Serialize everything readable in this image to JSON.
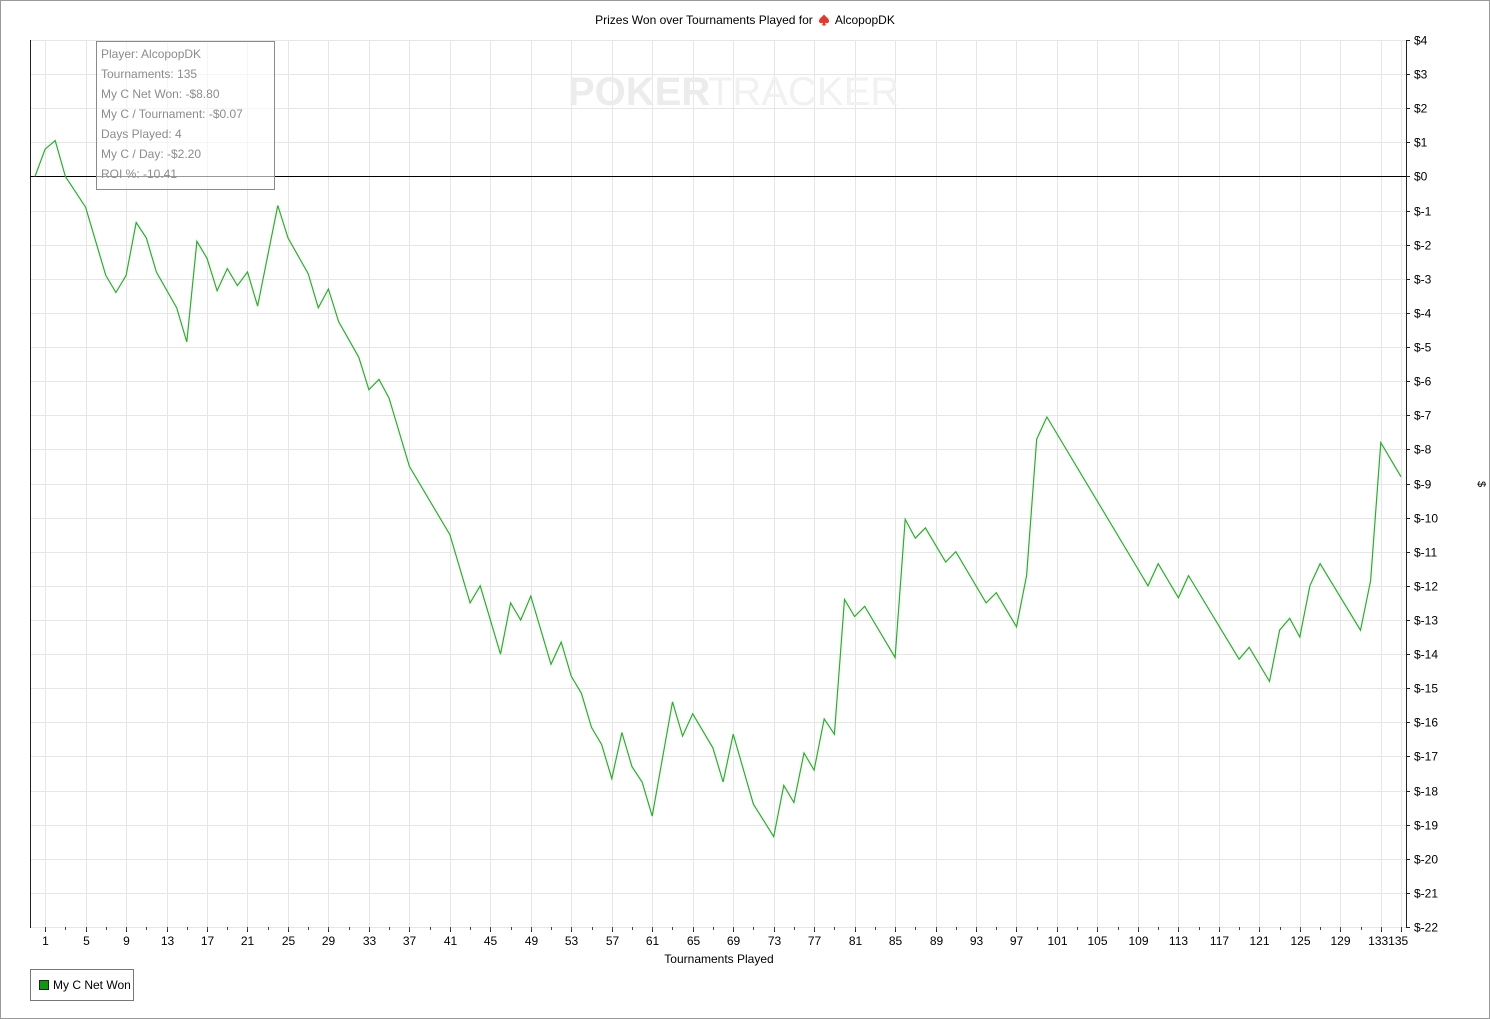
{
  "title": {
    "text": "Prizes Won over Tournaments Played for",
    "player": "AlcopopDK",
    "icon": "spade-icon"
  },
  "stats": {
    "player": "Player: AlcopopDK",
    "tournaments": "Tournaments: 135",
    "net_won": "My C Net Won: -$8.80",
    "per_tournament": "My C / Tournament: -$0.07",
    "days_played": "Days Played: 4",
    "per_day": "My C / Day: -$2.20",
    "roi": "ROI %: -10.41"
  },
  "watermark": {
    "left": "POKER",
    "right": "TRACKER"
  },
  "legend": {
    "label": "My C Net Won"
  },
  "colors": {
    "series": "#22b422",
    "grid": "#e6e6e6",
    "legend_swatch": "#0a9a0a",
    "spade": "#e8382b"
  },
  "chart_data": {
    "type": "line",
    "title": "Prizes Won over Tournaments Played for AlcopopDK",
    "xlabel": "Tournaments Played",
    "ylabel": "$",
    "xlim": [
      0,
      135
    ],
    "ylim": [
      -22,
      4
    ],
    "y_axis_position": "right",
    "grid": true,
    "legend_position": "bottom-left",
    "x_ticks": [
      1,
      5,
      9,
      13,
      17,
      21,
      25,
      29,
      33,
      37,
      41,
      45,
      49,
      53,
      57,
      61,
      65,
      69,
      73,
      77,
      81,
      85,
      89,
      93,
      97,
      101,
      105,
      109,
      113,
      117,
      121,
      125,
      129,
      133,
      135
    ],
    "x_tick_labels": [
      "1",
      "5",
      "9",
      "13",
      "17",
      "21",
      "25",
      "29",
      "33",
      "37",
      "41",
      "45",
      "49",
      "53",
      "57",
      "61",
      "65",
      "69",
      "73",
      "77",
      "81",
      "85",
      "89",
      "93",
      "97",
      "101",
      "105",
      "109",
      "113",
      "117",
      "121",
      "125",
      "129",
      "1331",
      "35"
    ],
    "y_ticks": [
      4,
      3,
      2,
      1,
      0,
      -1,
      -2,
      -3,
      -4,
      -5,
      -6,
      -7,
      -8,
      -9,
      -10,
      -11,
      -12,
      -13,
      -14,
      -15,
      -16,
      -17,
      -18,
      -19,
      -20,
      -21,
      -22
    ],
    "y_tick_labels": [
      "$4",
      "$3",
      "$2",
      "$1",
      "$0",
      "$-1",
      "$-2",
      "$-3",
      "$-4",
      "$-5",
      "$-6",
      "$-7",
      "$-8",
      "$-9",
      "$-10",
      "$-11",
      "$-12",
      "$-13",
      "$-14",
      "$-15",
      "$-16",
      "$-17",
      "$-18",
      "$-19",
      "$-20",
      "$-21",
      "$-22"
    ],
    "series": [
      {
        "name": "My C Net Won",
        "x": [
          0,
          1,
          2,
          3,
          5,
          7,
          8,
          9,
          10,
          11,
          12,
          14,
          15,
          16,
          17,
          18,
          19,
          20,
          21,
          22,
          24,
          25,
          27,
          28,
          29,
          30,
          32,
          33,
          34,
          35,
          37,
          41,
          43,
          44,
          46,
          47,
          48,
          49,
          51,
          52,
          53,
          54,
          55,
          56,
          57,
          58,
          59,
          60,
          61,
          63,
          64,
          65,
          67,
          68,
          69,
          71,
          73,
          74,
          75,
          76,
          77,
          78,
          79,
          80,
          81,
          82,
          85,
          86,
          87,
          88,
          90,
          91,
          94,
          95,
          97,
          98,
          99,
          100,
          110,
          111,
          113,
          114,
          119,
          120,
          122,
          123,
          124,
          125,
          126,
          127,
          131,
          132,
          133,
          135
        ],
        "y": [
          0,
          0.8,
          1.05,
          0,
          -0.9,
          -2.9,
          -3.4,
          -2.9,
          -1.35,
          -1.8,
          -2.8,
          -3.85,
          -4.85,
          -1.9,
          -2.4,
          -3.35,
          -2.7,
          -3.2,
          -2.8,
          -3.8,
          -0.85,
          -1.8,
          -2.85,
          -3.85,
          -3.3,
          -4.25,
          -5.3,
          -6.25,
          -5.95,
          -6.5,
          -8.5,
          -10.5,
          -12.5,
          -12,
          -14,
          -12.5,
          -13,
          -12.3,
          -14.3,
          -13.65,
          -14.65,
          -15.15,
          -16.15,
          -16.65,
          -17.65,
          -16.3,
          -17.3,
          -17.75,
          -18.75,
          -15.4,
          -16.4,
          -15.75,
          -16.75,
          -17.75,
          -16.35,
          -18.4,
          -19.35,
          -17.85,
          -18.35,
          -16.9,
          -17.4,
          -15.9,
          -16.35,
          -12.4,
          -12.9,
          -12.6,
          -14.1,
          -10.05,
          -10.6,
          -10.3,
          -11.3,
          -11,
          -12.5,
          -12.2,
          -13.2,
          -11.7,
          -7.7,
          -7.05,
          -12,
          -11.35,
          -12.35,
          -11.7,
          -14.15,
          -13.8,
          -14.8,
          -13.3,
          -12.95,
          -13.5,
          -12,
          -11.35,
          -13.3,
          -11.85,
          -7.8,
          -8.8
        ]
      }
    ]
  }
}
